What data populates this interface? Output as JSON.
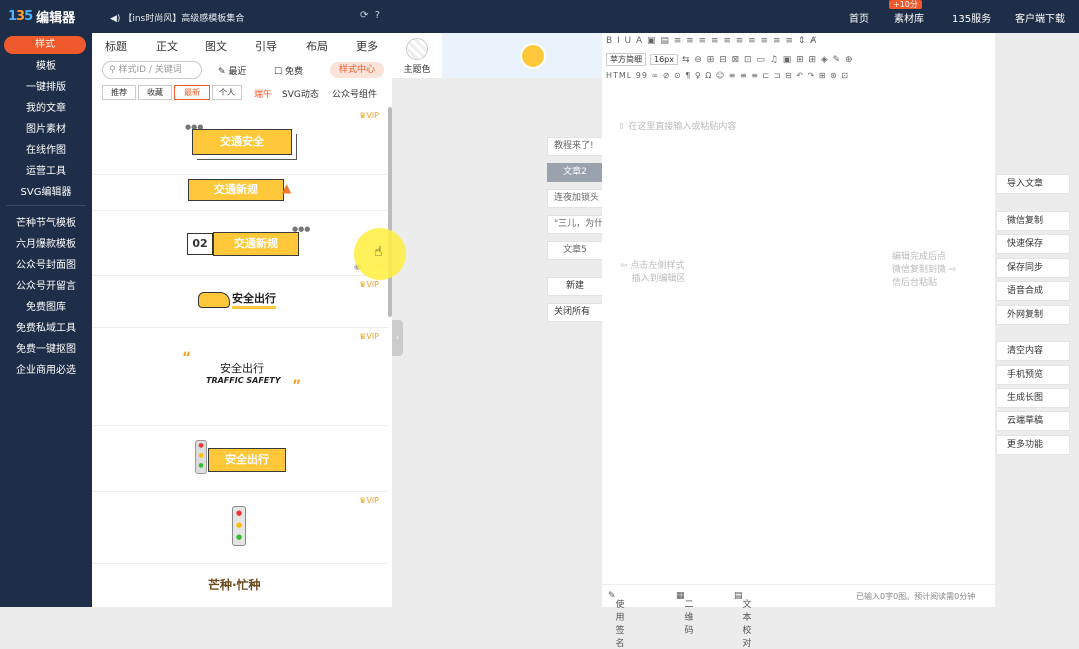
{
  "header": {
    "logo_part1": "1",
    "logo_part2": "3",
    "logo_part3": "5",
    "logo_text": "编辑器",
    "doc_title": "【ins时尚风】高级感模板集合",
    "nav": [
      "首页",
      "素材库",
      "135服务",
      "客户端下载"
    ],
    "nav_badge": "+10分"
  },
  "sidebar": {
    "active": "样式",
    "items": [
      "模板",
      "一键排版",
      "我的文章",
      "图片素材",
      "在线作图",
      "运营工具",
      "SVG编辑器"
    ],
    "items2": [
      "芒种节气模板",
      "六月爆款模板",
      "公众号封面图",
      "公众号开留言",
      "免费图库",
      "免费私域工具",
      "免费一键抠图",
      "企业商用必选"
    ]
  },
  "panel": {
    "tabs": [
      "标题",
      "正文",
      "图文",
      "引导",
      "布局",
      "更多"
    ],
    "search_placeholder": "样式ID / 关键词",
    "recent": "最近",
    "free": "免费",
    "style_center": "样式中心",
    "filters": [
      "推荐",
      "收藏",
      "最新",
      "个人"
    ],
    "filter_extra": [
      "端午",
      "SVG动态",
      "公众号组件"
    ],
    "vip": "VIP",
    "templates": {
      "t1": "交通安全",
      "t2": "交通新规",
      "t3_num": "02",
      "t3": "交通新规",
      "t4": "安全出行",
      "t5": "安全出行",
      "t5_en": "TRAFFIC SAFETY",
      "t6": "安全出行",
      "t8": "芒种·忙种"
    }
  },
  "theme": {
    "label": "主题色"
  },
  "articles": {
    "items": [
      "教程来了!",
      "文章2",
      "连夜加锁头",
      "\"三儿，为什",
      "文章5"
    ],
    "new": "新建",
    "close_all": "关闭所有"
  },
  "editor": {
    "font_family": "苹方简细",
    "font_size": "16px",
    "toolbar_row1": "B  I  U  A  ▣  ▤  ≡  ≡  ≡  ≡  ≡  ≡  ≡  ≡  ≡  ≡  ⇕  Ⱥ",
    "toolbar_row2": "⇆  ⊖  ⊞  ⊟  ⊠  ⊡  ▭  ♫  ▣  ⊞  ⊞  ◈  ✎  ⊕",
    "toolbar_row3": "HTML  99  ∞  ⊘  ⊙  ¶  ♀  Ω  ☺  ≡  ≡  ≡  ⊏  ⊐  ⊟  ↶  ↷  ⊞  ⊛  ⊡",
    "placeholder": "在这里直接输入或粘贴内容",
    "hint_left_1": "点击左侧样式",
    "hint_left_2": "插入到编辑区",
    "hint_right_1": "编辑完成后点",
    "hint_right_2": "微信复制到微",
    "hint_right_3": "信后台粘贴",
    "status_sign": "使用签名",
    "status_qr": "二维码",
    "status_proof": "文本校对",
    "status_count": "已输入0字0图。预计阅读需0分钟"
  },
  "right": {
    "import": "导入文章",
    "group1": [
      "微信复制",
      "快速保存",
      "保存同步",
      "语音合成",
      "外网复制"
    ],
    "group2": [
      "清空内容",
      "手机预览",
      "生成长图",
      "云端草稿",
      "更多功能"
    ]
  },
  "colors": {
    "sidebar_bg": "#1f2e48",
    "accent": "#f05a28",
    "tag_yellow": "#ffc83a"
  }
}
